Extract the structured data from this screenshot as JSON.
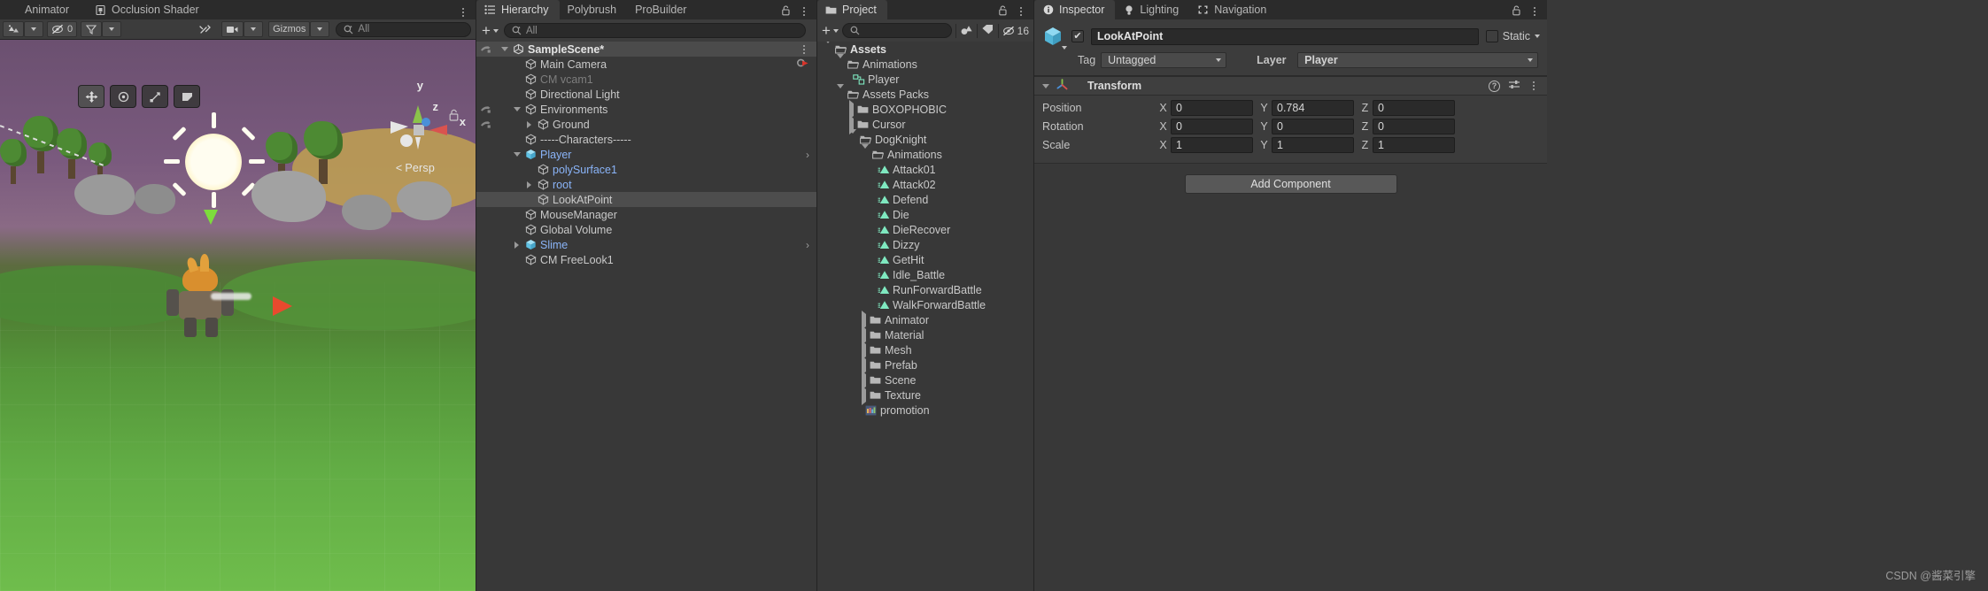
{
  "scene_panel": {
    "tabs": [
      {
        "label": "Animator",
        "icon": "animator-icon",
        "active": false
      },
      {
        "label": "Occlusion Shader",
        "icon": "occlusion-icon",
        "active": false
      }
    ],
    "toolbar": {
      "shaded_label": "",
      "gizmo_count": "0",
      "gizmos_label": "Gizmos",
      "search_placeholder": "All",
      "search_value": ""
    },
    "viewport": {
      "persp_label": "Persp",
      "axis_x": "x",
      "axis_y": "y",
      "axis_z": "z"
    }
  },
  "hierarchy": {
    "tabs": [
      {
        "label": "Hierarchy",
        "icon": "hierarchy-icon",
        "active": true
      },
      {
        "label": "Polybrush",
        "icon": "",
        "active": false
      },
      {
        "label": "ProBuilder",
        "icon": "",
        "active": false
      }
    ],
    "toolbar": {
      "add_label": "+",
      "search_placeholder": "All",
      "search_value": ""
    },
    "items": [
      {
        "label": "SampleScene*",
        "indent": 0,
        "icon": "unity-scene-icon",
        "twisty": "down",
        "kind": "scene",
        "hand": true
      },
      {
        "label": "Main Camera",
        "indent": 1,
        "icon": "gameobject-icon",
        "twisty": "none",
        "kind": "normal",
        "badge": "camera-flag"
      },
      {
        "label": "CM vcam1",
        "indent": 1,
        "icon": "gameobject-icon",
        "twisty": "none",
        "kind": "dim"
      },
      {
        "label": "Directional Light",
        "indent": 1,
        "icon": "gameobject-icon",
        "twisty": "none",
        "kind": "normal"
      },
      {
        "label": "Environments",
        "indent": 1,
        "icon": "gameobject-icon",
        "twisty": "down",
        "kind": "normal",
        "hand": true
      },
      {
        "label": "Ground",
        "indent": 2,
        "icon": "gameobject-icon",
        "twisty": "right",
        "kind": "normal",
        "hand": true
      },
      {
        "label": "-----Characters-----",
        "indent": 1,
        "icon": "gameobject-icon",
        "twisty": "none",
        "kind": "normal"
      },
      {
        "label": "Player",
        "indent": 1,
        "icon": "prefab-icon",
        "twisty": "down",
        "kind": "prefab",
        "arrow": true
      },
      {
        "label": "polySurface1",
        "indent": 2,
        "icon": "gameobject-icon",
        "twisty": "none",
        "kind": "prefab"
      },
      {
        "label": "root",
        "indent": 2,
        "icon": "gameobject-icon",
        "twisty": "right",
        "kind": "prefab"
      },
      {
        "label": "LookAtPoint",
        "indent": 2,
        "icon": "gameobject-icon",
        "twisty": "none",
        "kind": "selected"
      },
      {
        "label": "MouseManager",
        "indent": 1,
        "icon": "gameobject-icon",
        "twisty": "none",
        "kind": "normal"
      },
      {
        "label": "Global Volume",
        "indent": 1,
        "icon": "gameobject-icon",
        "twisty": "none",
        "kind": "normal"
      },
      {
        "label": "Slime",
        "indent": 1,
        "icon": "prefab-icon",
        "twisty": "right",
        "kind": "prefab",
        "arrow": true
      },
      {
        "label": "CM FreeLook1",
        "indent": 1,
        "icon": "gameobject-icon",
        "twisty": "none",
        "kind": "normal"
      }
    ]
  },
  "project": {
    "tabs": [
      {
        "label": "Project",
        "icon": "folder-icon",
        "active": true
      }
    ],
    "toolbar": {
      "add_label": "+",
      "search_placeholder": "",
      "search_value": "",
      "hidden_count": "16"
    },
    "items": [
      {
        "label": "Assets",
        "indent": 0,
        "icon": "folder-open-icon",
        "twisty": "down",
        "bold": true
      },
      {
        "label": "Animations",
        "indent": 1,
        "icon": "folder-open-icon",
        "twisty": "down",
        "bold": false
      },
      {
        "label": "Player",
        "indent": 2,
        "icon": "animator-controller-icon",
        "twisty": "none",
        "bold": false
      },
      {
        "label": "Assets Packs",
        "indent": 1,
        "icon": "folder-open-icon",
        "twisty": "down",
        "bold": false
      },
      {
        "label": "BOXOPHOBIC",
        "indent": 2,
        "icon": "folder-icon",
        "twisty": "right",
        "bold": false
      },
      {
        "label": "Cursor",
        "indent": 2,
        "icon": "folder-icon",
        "twisty": "right",
        "bold": false
      },
      {
        "label": "DogKnight",
        "indent": 2,
        "icon": "folder-open-icon",
        "twisty": "down",
        "bold": false
      },
      {
        "label": "Animations",
        "indent": 3,
        "icon": "folder-open-icon",
        "twisty": "down",
        "bold": false
      },
      {
        "label": "Attack01",
        "indent": 4,
        "icon": "animation-clip-icon",
        "twisty": "none",
        "bold": false
      },
      {
        "label": "Attack02",
        "indent": 4,
        "icon": "animation-clip-icon",
        "twisty": "none",
        "bold": false
      },
      {
        "label": "Defend",
        "indent": 4,
        "icon": "animation-clip-icon",
        "twisty": "none",
        "bold": false
      },
      {
        "label": "Die",
        "indent": 4,
        "icon": "animation-clip-icon",
        "twisty": "none",
        "bold": false
      },
      {
        "label": "DieRecover",
        "indent": 4,
        "icon": "animation-clip-icon",
        "twisty": "none",
        "bold": false
      },
      {
        "label": "Dizzy",
        "indent": 4,
        "icon": "animation-clip-icon",
        "twisty": "none",
        "bold": false
      },
      {
        "label": "GetHit",
        "indent": 4,
        "icon": "animation-clip-icon",
        "twisty": "none",
        "bold": false
      },
      {
        "label": "Idle_Battle",
        "indent": 4,
        "icon": "animation-clip-icon",
        "twisty": "none",
        "bold": false
      },
      {
        "label": "RunForwardBattle",
        "indent": 4,
        "icon": "animation-clip-icon",
        "twisty": "none",
        "bold": false
      },
      {
        "label": "WalkForwardBattle",
        "indent": 4,
        "icon": "animation-clip-icon",
        "twisty": "none",
        "bold": false
      },
      {
        "label": "Animator",
        "indent": 3,
        "icon": "folder-icon",
        "twisty": "right",
        "bold": false
      },
      {
        "label": "Material",
        "indent": 3,
        "icon": "folder-icon",
        "twisty": "right",
        "bold": false
      },
      {
        "label": "Mesh",
        "indent": 3,
        "icon": "folder-icon",
        "twisty": "right",
        "bold": false
      },
      {
        "label": "Prefab",
        "indent": 3,
        "icon": "folder-icon",
        "twisty": "right",
        "bold": false
      },
      {
        "label": "Scene",
        "indent": 3,
        "icon": "folder-icon",
        "twisty": "right",
        "bold": false
      },
      {
        "label": "Texture",
        "indent": 3,
        "icon": "folder-icon",
        "twisty": "right",
        "bold": false
      },
      {
        "label": "promotion",
        "indent": 3,
        "icon": "texture-icon",
        "twisty": "none",
        "bold": false
      }
    ]
  },
  "inspector": {
    "tabs": [
      {
        "label": "Inspector",
        "icon": "info-icon",
        "active": true
      },
      {
        "label": "Lighting",
        "icon": "bulb-icon",
        "active": false
      },
      {
        "label": "Navigation",
        "icon": "navigation-icon",
        "active": false
      }
    ],
    "object": {
      "enabled_checkmark": "✔",
      "name": "LookAtPoint",
      "static_label": "Static",
      "tag_label": "Tag",
      "tag_value": "Untagged",
      "layer_label": "Layer",
      "layer_value": "Player"
    },
    "transform": {
      "title": "Transform",
      "rows": [
        {
          "label": "Position",
          "x": "0",
          "y": "0.784",
          "z": "0"
        },
        {
          "label": "Rotation",
          "x": "0",
          "y": "0",
          "z": "0"
        },
        {
          "label": "Scale",
          "x": "1",
          "y": "1",
          "z": "1"
        }
      ],
      "axis_labels": {
        "x": "X",
        "y": "Y",
        "z": "Z"
      }
    },
    "add_component_label": "Add Component"
  },
  "watermark": "CSDN @酱菜引擎",
  "colors": {
    "panel_bg": "#383838",
    "chrome_bg": "#3c3c3c",
    "tab_inactive_bg": "#2b2b2b",
    "selection": "#4d4d4d",
    "prefab_blue": "#8ab4f8",
    "anim_clip_green": "#7fe8c0",
    "accent_x": "#d9534f",
    "accent_y": "#8bc34a",
    "accent_z": "#4a90d9"
  }
}
